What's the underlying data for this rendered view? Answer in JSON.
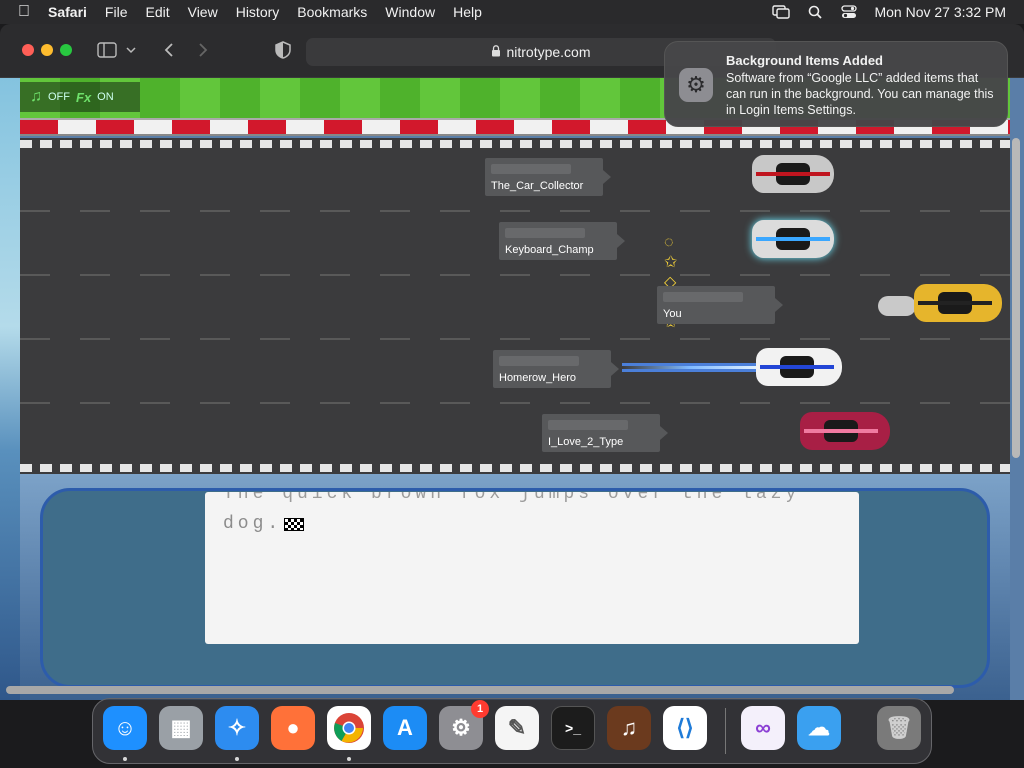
{
  "menubar": {
    "app_name": "Safari",
    "items": [
      "File",
      "Edit",
      "View",
      "History",
      "Bookmarks",
      "Window",
      "Help"
    ],
    "datetime": "Mon Nov 27  3:32 PM"
  },
  "browser": {
    "url": "nitrotype.com"
  },
  "game": {
    "sound": {
      "music_state": "OFF",
      "fx_label": "Fx",
      "fx_state": "ON"
    },
    "racers": [
      {
        "name": "The_Car_Collector",
        "car_color": "#c8c8c8"
      },
      {
        "name": "Keyboard_Champ",
        "car_color": "#dcdcdc"
      },
      {
        "name": "You",
        "car_color": "#e6b52c"
      },
      {
        "name": "Homerow_Hero",
        "car_color": "#f2f2f2"
      },
      {
        "name": "I_Love_2_Type",
        "car_color": "#a81f45"
      }
    ],
    "text_previous": "The quick brown fox jumps over the lazy",
    "text_current": "dog."
  },
  "notification": {
    "title": "Background Items Added",
    "body": "Software from “Google LLC” added items that can run in the background. You can manage this in Login Items Settings."
  },
  "dock": {
    "items": [
      {
        "name": "Finder",
        "icon": "finder-icon",
        "color": "#1e90ff"
      },
      {
        "name": "Launchpad",
        "icon": "launchpad-icon",
        "color": "#9aa0a6"
      },
      {
        "name": "Safari",
        "icon": "safari-icon",
        "color": "#2d8cf0"
      },
      {
        "name": "Firefox",
        "icon": "firefox-icon",
        "color": "#ff7139"
      },
      {
        "name": "Chrome",
        "icon": "chrome-icon",
        "color": "#ffffff"
      },
      {
        "name": "App Store",
        "icon": "app-store-icon",
        "color": "#1c8cf5"
      },
      {
        "name": "System Settings",
        "icon": "system-settings-icon",
        "color": "#8e8e93",
        "badge": "1"
      },
      {
        "name": "TextEdit",
        "icon": "textedit-icon",
        "color": "#f5f5f5"
      },
      {
        "name": "Terminal",
        "icon": "terminal-icon",
        "color": "#1c1c1c"
      },
      {
        "name": "GarageBand",
        "icon": "garageband-icon",
        "color": "#6b3a1e"
      },
      {
        "name": "Visual Studio Code",
        "icon": "vscode-icon",
        "color": "#ffffff"
      },
      {
        "name": "Visual Studio",
        "icon": "visual-studio-icon",
        "color": "#f4f0fb"
      },
      {
        "name": "Weather",
        "icon": "weather-icon",
        "color": "#3aa0f0"
      },
      {
        "name": "Trash",
        "icon": "trash-icon",
        "color": "#7a7a7a"
      }
    ]
  }
}
